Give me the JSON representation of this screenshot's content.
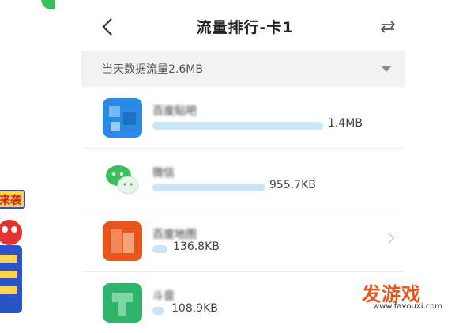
{
  "screen": {
    "title": "流量排行-卡1",
    "summary": "当天数据流量2.6MB"
  },
  "apps": [
    {
      "name": "百度贴吧",
      "usage": "1.4MB",
      "fraction": 1.0,
      "icon": "blue-app-icon",
      "color": "#2a8be6"
    },
    {
      "name": "微信",
      "usage": "955.7KB",
      "fraction": 0.66,
      "icon": "wechat-icon",
      "color": "#3bbf5a"
    },
    {
      "name": "百度地图",
      "usage": "136.8KB",
      "fraction": 0.09,
      "icon": "orange-app-icon",
      "color": "#e8551a",
      "has_chevron": true
    },
    {
      "name": "斗音",
      "usage": "108.9KB",
      "fraction": 0.07,
      "icon": "green-app-icon",
      "color": "#2fb56b"
    }
  ],
  "decor": {
    "badge_text": "来袭"
  },
  "watermark": {
    "main": "发游戏",
    "sub": "www.favouxi.com"
  }
}
